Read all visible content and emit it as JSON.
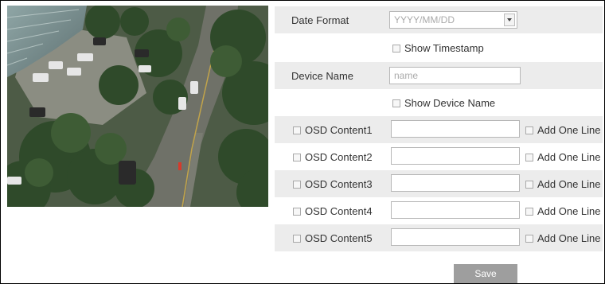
{
  "form": {
    "date_format": {
      "label": "Date Format",
      "value": "YYYY/MM/DD"
    },
    "show_timestamp": {
      "label": "Show Timestamp",
      "checked": false
    },
    "device_name": {
      "label": "Device Name",
      "placeholder": "name"
    },
    "show_device_name": {
      "label": "Show Device Name",
      "checked": false
    },
    "osd_rows": [
      {
        "label": "OSD Content1",
        "value": "",
        "add_line_label": "Add One Line"
      },
      {
        "label": "OSD Content2",
        "value": "",
        "add_line_label": "Add One Line"
      },
      {
        "label": "OSD Content3",
        "value": "",
        "add_line_label": "Add One Line"
      },
      {
        "label": "OSD Content4",
        "value": "",
        "add_line_label": "Add One Line"
      },
      {
        "label": "OSD Content5",
        "value": "",
        "add_line_label": "Add One Line"
      }
    ],
    "save_label": "Save"
  },
  "colors": {
    "row_shade": "#ececec",
    "save_button": "#9e9e9e"
  }
}
